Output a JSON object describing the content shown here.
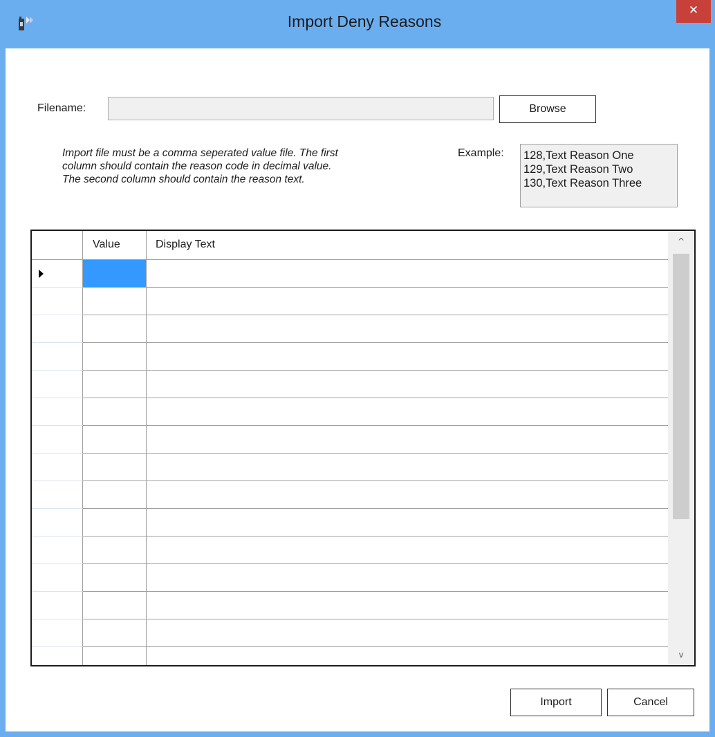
{
  "window": {
    "title": "Import Deny Reasons",
    "close_glyph": "✕",
    "app_icon": "radio-icon",
    "colors": {
      "titlebar": "#6aaef0",
      "close_button": "#c7413a",
      "selection": "#3399ff"
    }
  },
  "form": {
    "filename_label": "Filename:",
    "filename_value": "",
    "browse_label": "Browse",
    "hint_lines": [
      "Import file must be a comma seperated value file.  The first",
      "column should contain the reason code in decimal value.",
      "The second column should contain the reason text."
    ],
    "example_label": "Example:",
    "example_lines": [
      "128,Text Reason One",
      "129,Text Reason Two",
      "130,Text Reason Three"
    ]
  },
  "grid": {
    "columns": [
      "Value",
      "Display Text"
    ],
    "current_row_indicator": "▶",
    "selected_cell": "Value",
    "rows": [
      {
        "value": "",
        "display_text": ""
      },
      {
        "value": "",
        "display_text": ""
      },
      {
        "value": "",
        "display_text": ""
      },
      {
        "value": "",
        "display_text": ""
      },
      {
        "value": "",
        "display_text": ""
      },
      {
        "value": "",
        "display_text": ""
      },
      {
        "value": "",
        "display_text": ""
      },
      {
        "value": "",
        "display_text": ""
      },
      {
        "value": "",
        "display_text": ""
      },
      {
        "value": "",
        "display_text": ""
      },
      {
        "value": "",
        "display_text": ""
      },
      {
        "value": "",
        "display_text": ""
      },
      {
        "value": "",
        "display_text": ""
      },
      {
        "value": "",
        "display_text": ""
      },
      {
        "value": "",
        "display_text": ""
      }
    ],
    "scroll_up_glyph": "^",
    "scroll_down_glyph": "v"
  },
  "footer": {
    "import_label": "Import",
    "cancel_label": "Cancel"
  }
}
